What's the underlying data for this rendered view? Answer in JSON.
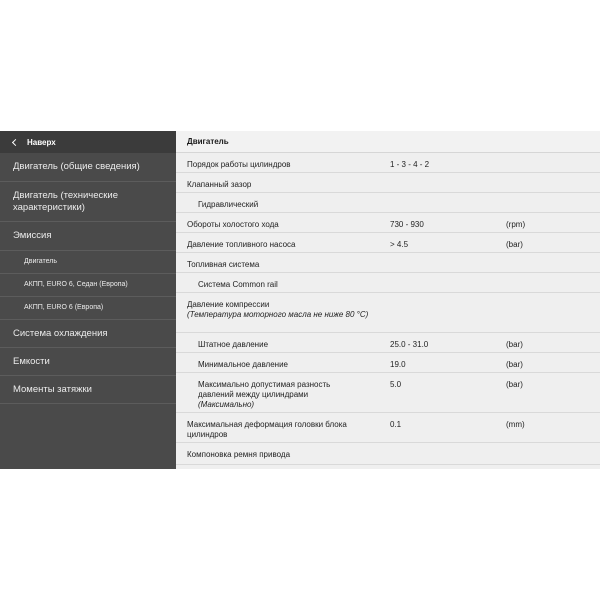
{
  "sidebar": {
    "back_label": "Наверх",
    "items": [
      {
        "label": "Двигатель (общие сведения)"
      },
      {
        "label": "Двигатель (технические характеристики)"
      },
      {
        "label": "Эмиссия"
      },
      {
        "label": "Двигатель"
      },
      {
        "label": "АКПП, EURO 6, Седан (Европа)"
      },
      {
        "label": "АКПП, EURO 6 (Европа)"
      },
      {
        "label": "Система охлаждения"
      },
      {
        "label": "Емкости"
      },
      {
        "label": "Моменты затяжки"
      }
    ]
  },
  "main": {
    "section_title": "Двигатель",
    "rows": [
      {
        "label": "Порядок работы цилиндров",
        "value": "1 - 3 - 4 - 2",
        "unit": ""
      },
      {
        "label": "Клапанный зазор",
        "value": "",
        "unit": ""
      },
      {
        "label": "Гидравлический",
        "value": "",
        "unit": ""
      },
      {
        "label": "Обороты холостого хода",
        "value": "730 - 930",
        "unit": "(rpm)"
      },
      {
        "label": "Давление топливного насоса",
        "value": "> 4.5",
        "unit": "(bar)"
      },
      {
        "label": "Топливная система",
        "value": "",
        "unit": ""
      },
      {
        "label": "Система Common rail",
        "value": "",
        "unit": ""
      },
      {
        "label": "Давление компрессии",
        "note": "(Температура моторного масла не ниже 80 °C)",
        "value": "",
        "unit": ""
      },
      {
        "label": "Штатное давление",
        "value": "25.0 - 31.0",
        "unit": "(bar)"
      },
      {
        "label": "Минимальное давление",
        "value": "19.0",
        "unit": "(bar)"
      },
      {
        "label": "Максимально допустимая разность давлений между цилиндрами",
        "note": "(Максимально)",
        "value": "5.0",
        "unit": "(bar)"
      },
      {
        "label": "Максимальная деформация головки блока цилиндров",
        "value": "0.1",
        "unit": "(mm)"
      },
      {
        "label": "Компоновка ремня привода",
        "value": "",
        "unit": ""
      }
    ]
  }
}
